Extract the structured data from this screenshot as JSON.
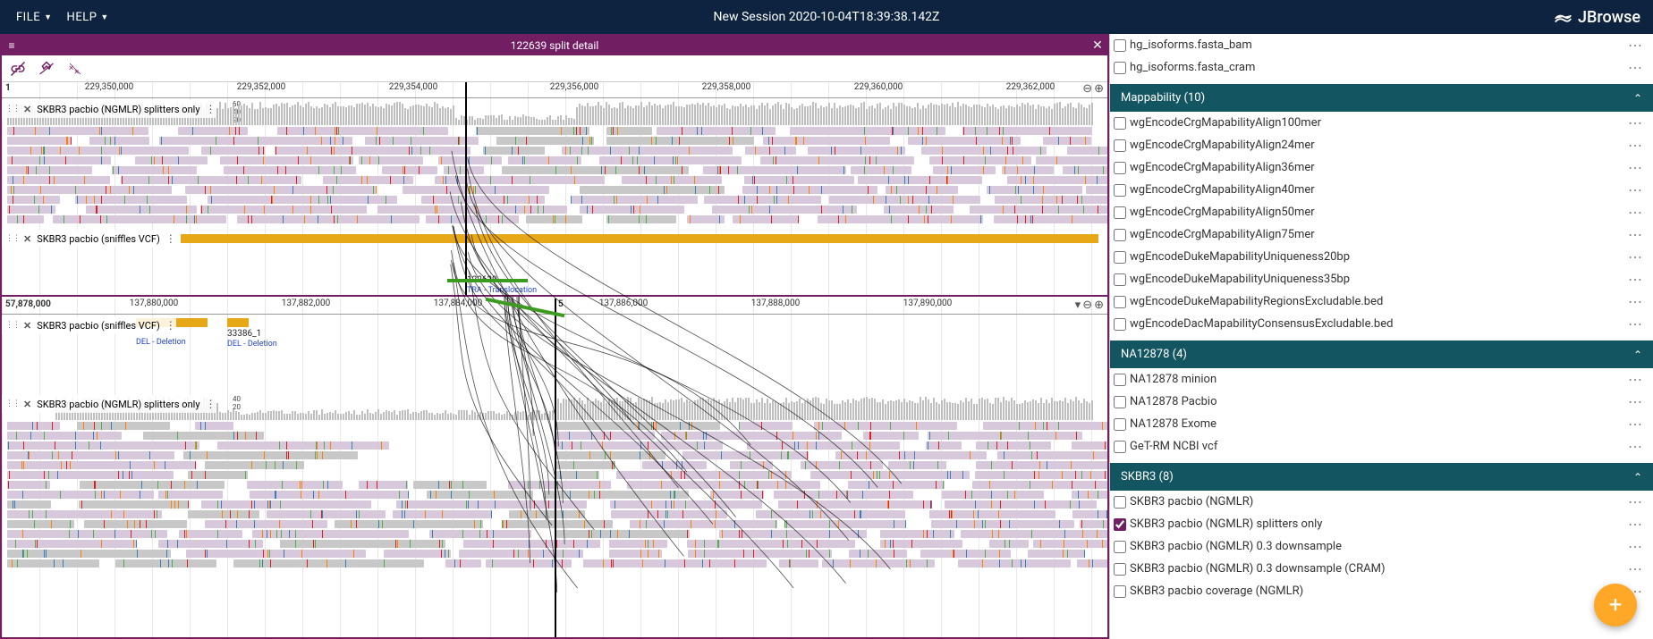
{
  "menubar": {
    "file": "FILE",
    "help": "HELP",
    "session": "New Session 2020-10-04T18:39:38.142Z",
    "brand": "JBrowse"
  },
  "view": {
    "title": "122639 split detail"
  },
  "region1": {
    "chr": "1",
    "ticks": [
      "229,350,000",
      "229,352,000",
      "229,354,000",
      "229,356,000",
      "229,358,000",
      "229,360,000",
      "229,362,000"
    ],
    "tracks": {
      "align": "SKBR3 pacbio (NGMLR) splitters only",
      "vcf": "SKBR3 pacbio (sniffles VCF)"
    },
    "cov_axis": [
      "60",
      "40",
      "20"
    ],
    "variant": {
      "id": "122639",
      "type": "TRA - Translocation"
    }
  },
  "region2": {
    "chr_left": "57,878,000",
    "chr": "5",
    "ticks": [
      "137,880,000",
      "137,882,000",
      "137,884,000",
      "137,886,000",
      "137,888,000",
      "137,890,000"
    ],
    "tracks": {
      "vcf": "SKBR3 pacbio (sniffles VCF)",
      "align": "SKBR3 pacbio (NGMLR) splitters only"
    },
    "cov_axis": [
      "40",
      "20"
    ],
    "variant": {
      "id": "33386_1",
      "type": "DEL - Deletion",
      "type2": "DEL - Deletion"
    }
  },
  "sidebar": {
    "orphan": [
      "hg_isoforms.fasta_bam",
      "hg_isoforms.fasta_cram"
    ],
    "categories": [
      {
        "name": "Mappability",
        "count": 10,
        "tracks": [
          {
            "n": "wgEncodeCrgMapabilityAlign100mer",
            "c": false
          },
          {
            "n": "wgEncodeCrgMapabilityAlign24mer",
            "c": false
          },
          {
            "n": "wgEncodeCrgMapabilityAlign36mer",
            "c": false
          },
          {
            "n": "wgEncodeCrgMapabilityAlign40mer",
            "c": false
          },
          {
            "n": "wgEncodeCrgMapabilityAlign50mer",
            "c": false
          },
          {
            "n": "wgEncodeCrgMapabilityAlign75mer",
            "c": false
          },
          {
            "n": "wgEncodeDukeMapabilityUniqueness20bp",
            "c": false
          },
          {
            "n": "wgEncodeDukeMapabilityUniqueness35bp",
            "c": false
          },
          {
            "n": "wgEncodeDukeMapabilityRegionsExcludable.bed",
            "c": false
          },
          {
            "n": "wgEncodeDacMapabilityConsensusExcludable.bed",
            "c": false
          }
        ]
      },
      {
        "name": "NA12878",
        "count": 4,
        "tracks": [
          {
            "n": "NA12878 minion",
            "c": false
          },
          {
            "n": "NA12878 Pacbio",
            "c": false
          },
          {
            "n": "NA12878 Exome",
            "c": false
          },
          {
            "n": "GeT-RM NCBI vcf",
            "c": false
          }
        ]
      },
      {
        "name": "SKBR3",
        "count": 8,
        "tracks": [
          {
            "n": "SKBR3 pacbio (NGMLR)",
            "c": false
          },
          {
            "n": "SKBR3 pacbio (NGMLR) splitters only",
            "c": true
          },
          {
            "n": "SKBR3 pacbio (NGMLR) 0.3 downsample",
            "c": false
          },
          {
            "n": "SKBR3 pacbio (NGMLR) 0.3 downsample (CRAM)",
            "c": false
          },
          {
            "n": "SKBR3 pacbio coverage (NGMLR)",
            "c": false
          }
        ]
      }
    ]
  }
}
